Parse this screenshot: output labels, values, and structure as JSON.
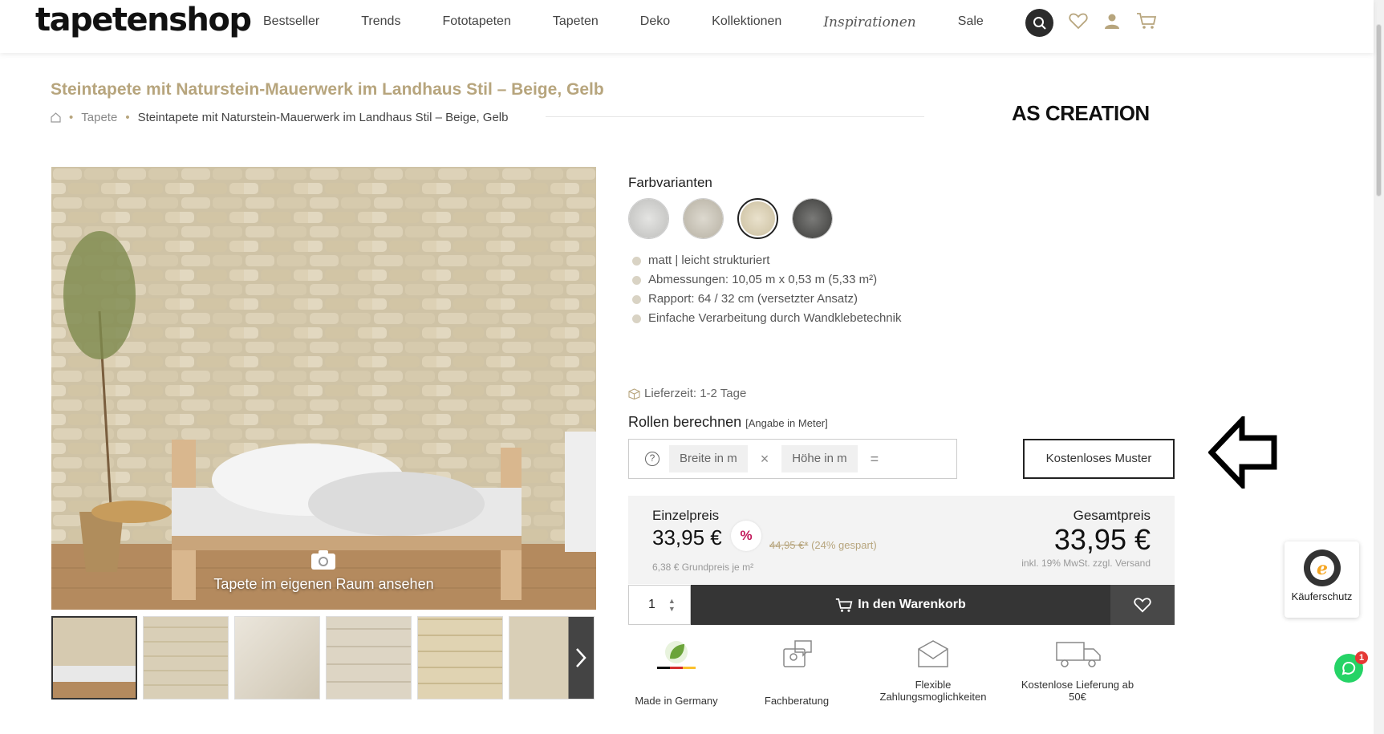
{
  "header": {
    "logo": "tapetenshop",
    "nav": [
      "Bestseller",
      "Trends",
      "Fototapeten",
      "Tapeten",
      "Deko",
      "Kollektionen",
      "Inspirationen",
      "Sale"
    ]
  },
  "product": {
    "title": "Steintapete mit Naturstein-Mauerwerk im Landhaus Stil – Beige, Gelb",
    "breadcrumb": [
      "Tapete",
      "Steintapete mit Naturstein-Mauerwerk im Landhaus Stil – Beige, Gelb"
    ],
    "brand": "AS CREATION",
    "camera_label": "Tapete im eigenen Raum ansehen",
    "color_variants_label": "Farbvarianten",
    "features": [
      "matt | leicht strukturiert",
      "Abmessungen: 10,05 m x 0,53 m (5,33 m²)",
      "Rapport: 64 / 32 cm (versetzter Ansatz)",
      "Einfache Verarbeitung durch Wandklebetechnik"
    ],
    "delivery": "Lieferzeit: 1-2 Tage"
  },
  "calculator": {
    "title": "Rollen berechnen",
    "subtitle": "[Angabe in Meter]",
    "width_placeholder": "Breite in m",
    "height_placeholder": "Höhe in m",
    "times": "×",
    "equals": "="
  },
  "sample_button": "Kostenloses Muster",
  "pricing": {
    "unit_label": "Einzelpreis",
    "unit_price": "33,95 €",
    "discount_symbol": "%",
    "old_price": "44,95 €*",
    "saved": "(24% gespart)",
    "base_price": "6,38 € Grundpreis je m²",
    "total_label": "Gesamtpreis",
    "total_price": "33,95 €",
    "tax_note": "inkl. 19% MwSt. zzgl. Versand"
  },
  "cart": {
    "quantity": "1",
    "add_label": "In den Warenkorb"
  },
  "usps": [
    {
      "label": "Made in Germany"
    },
    {
      "label": "Fachberatung"
    },
    {
      "label": "Flexible Zahlungsmoglichkeiten"
    },
    {
      "label": "Kostenlose Lieferung ab 50€"
    }
  ],
  "trusted": {
    "label": "Käuferschutz"
  },
  "whatsapp": {
    "badge": "1"
  },
  "colors": {
    "accent": "#b7a57d",
    "dark": "#353535",
    "discount": "#c2185b"
  }
}
